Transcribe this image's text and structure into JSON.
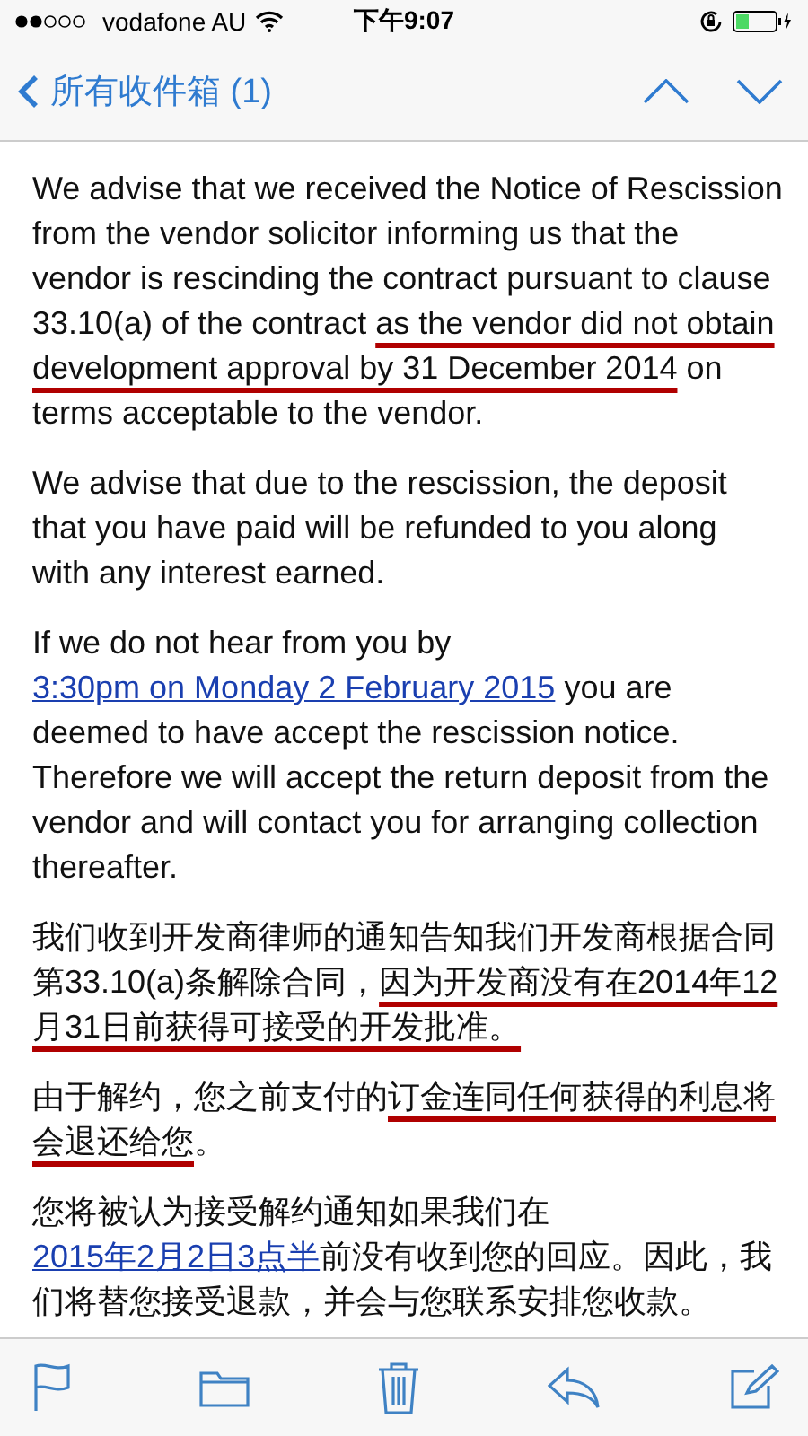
{
  "status_bar": {
    "carrier": "vodafone AU",
    "time": "下午9:07"
  },
  "nav_bar": {
    "back_label": "所有收件箱 (1)"
  },
  "message": {
    "paragraphs": [
      {
        "segments": [
          {
            "kind": "plain",
            "text": "We advise that we received the Notice of Rescission from the vendor solicitor informing us that the vendor is rescinding the contract pursuant to clause 33.10(a) of the contract "
          },
          {
            "kind": "marked",
            "text": "as the vendor did not obtain development approval by 31 December 2014"
          },
          {
            "kind": "plain",
            "text": " on terms acceptable to the vendor."
          }
        ]
      },
      {
        "segments": [
          {
            "kind": "plain",
            "text": "We advise that due to the rescission, the deposit that you have paid will be refunded to you along with any interest earned."
          }
        ]
      },
      {
        "segments": [
          {
            "kind": "plain",
            "text": "If we do not hear from you by "
          },
          {
            "kind": "link",
            "text": "3:30pm on Monday 2 February 2015"
          },
          {
            "kind": "plain",
            "text": " you are deemed to have accept the rescission notice. Therefore we will accept the return deposit from the vendor and will contact you for arranging collection thereafter."
          }
        ]
      },
      {
        "segments": [
          {
            "kind": "plain",
            "text": "我们收到开发商律师的通知告知我们开发商根据合同第33.10(a)条解除合同，"
          },
          {
            "kind": "marked",
            "text": "因为开发商没有在2014年12月31日前获得可接受的开发批准。"
          }
        ]
      },
      {
        "segments": [
          {
            "kind": "plain",
            "text": "由于解约，您之前支付的"
          },
          {
            "kind": "marked",
            "text": "订金连同任何获得的利息将会退还给您"
          },
          {
            "kind": "plain",
            "text": "。"
          }
        ]
      },
      {
        "segments": [
          {
            "kind": "plain",
            "text": "您将被认为接受解约通知如果我们在"
          },
          {
            "kind": "link",
            "text": "2015年2月2日3点半"
          },
          {
            "kind": "plain",
            "text": "前没有收到您的回应。因此，我们将替您接受退款，并会与您联系安排您收款。"
          }
        ]
      }
    ]
  }
}
